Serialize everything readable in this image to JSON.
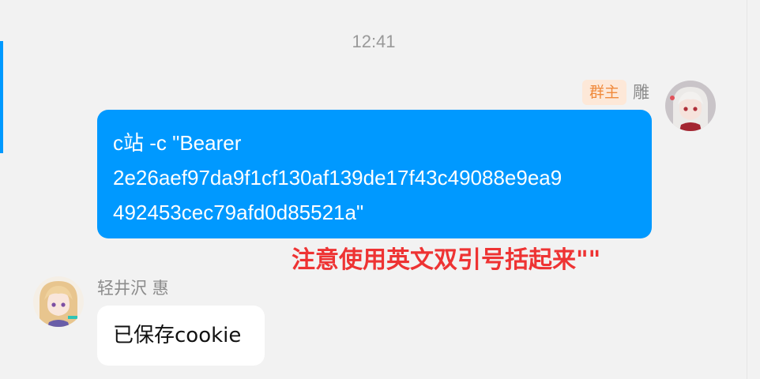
{
  "timestamp": "12:41",
  "colors": {
    "accent": "#0099ff",
    "outgoing_bubble": "#0099ff",
    "outgoing_text": "#ffffff",
    "incoming_bubble": "#ffffff",
    "incoming_text": "#111111",
    "annotation": "#ee3333",
    "badge_bg": "#fde8d8",
    "badge_text": "#f08a3c"
  },
  "messages": [
    {
      "sender": "雕",
      "badge": "群主",
      "avatar_icon": "anime-avatar-icon",
      "lines": [
        "c站 -c \"Bearer",
        "2e26aef97da9f1cf130af139de17f43c49088e9ea9",
        "492453cec79afd0d85521a\""
      ]
    },
    {
      "sender": "轻井沢 惠",
      "avatar_icon": "anime-avatar-icon",
      "text": "已保存cookie"
    }
  ],
  "annotation": "注意使用英文双引号括起来\"\""
}
